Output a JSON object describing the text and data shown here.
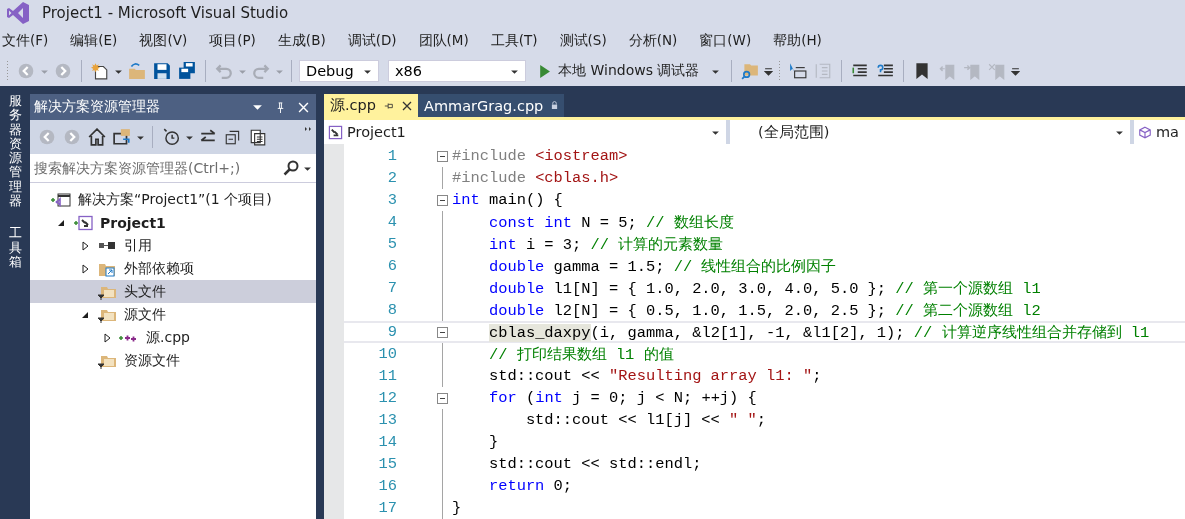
{
  "window": {
    "title": "Project1 - Microsoft Visual Studio"
  },
  "menu": [
    "文件(F)",
    "编辑(E)",
    "视图(V)",
    "项目(P)",
    "生成(B)",
    "调试(D)",
    "团队(M)",
    "工具(T)",
    "测试(S)",
    "分析(N)",
    "窗口(W)",
    "帮助(H)"
  ],
  "toolbar": {
    "configuration": "Debug",
    "platform": "x86",
    "run_label": "本地 Windows 调试器"
  },
  "side_strip": [
    "服务器资源管理器",
    "工具箱"
  ],
  "solution_explorer": {
    "title": "解决方案资源管理器",
    "search": {
      "placeholder": "搜索解决方案资源管理器(Ctrl+;)"
    },
    "tree": [
      {
        "label": "解决方案“Project1”(1 个项目)",
        "kind": "solution",
        "selected": false,
        "children": [
          {
            "label": "Project1",
            "kind": "project",
            "expanded": true,
            "selected": false,
            "children": [
              {
                "label": "引用",
                "kind": "references",
                "expanded": false,
                "selected": false
              },
              {
                "label": "外部依赖项",
                "kind": "external",
                "expanded": false,
                "selected": false
              },
              {
                "label": "头文件",
                "kind": "folder",
                "selected": true
              },
              {
                "label": "源文件",
                "kind": "folder",
                "expanded": true,
                "selected": false,
                "children": [
                  {
                    "label": "源.cpp",
                    "kind": "file",
                    "expanded": false,
                    "selected": false
                  }
                ]
              },
              {
                "label": "资源文件",
                "kind": "folder",
                "selected": false
              }
            ]
          }
        ]
      }
    ]
  },
  "editor": {
    "tabs": [
      {
        "label": "源.cpp",
        "selected": true
      },
      {
        "label": "AmmarGrag.cpp",
        "selected": false
      }
    ],
    "nav": {
      "project": "Project1",
      "scope": "(全局范围)",
      "member": "ma"
    },
    "lines": [
      {
        "number": "1",
        "fold": true,
        "current": false,
        "tokens": [
          {
            "text": "#include",
            "kind": "pp"
          },
          {
            "text": " <iostream>",
            "kind": "str"
          }
        ]
      },
      {
        "number": "2",
        "fold": false,
        "current": false,
        "tokens": [
          {
            "text": "#include",
            "kind": "pp"
          },
          {
            "text": " <cblas.h>",
            "kind": "str"
          }
        ]
      },
      {
        "number": "3",
        "fold": true,
        "current": false,
        "tokens": [
          {
            "text": "int",
            "kind": "kw"
          },
          {
            "text": " main() {",
            "kind": "tx"
          }
        ]
      },
      {
        "number": "4",
        "fold": false,
        "current": false,
        "tokens": [
          {
            "text": "    const int",
            "kind": "kw"
          },
          {
            "text": " N = 5; ",
            "kind": "tx"
          },
          {
            "text": "// 数组长度",
            "kind": "cm"
          }
        ]
      },
      {
        "number": "5",
        "fold": false,
        "current": false,
        "tokens": [
          {
            "text": "    int",
            "kind": "kw"
          },
          {
            "text": " i = 3; ",
            "kind": "tx"
          },
          {
            "text": "// 计算的元素数量",
            "kind": "cm"
          }
        ]
      },
      {
        "number": "6",
        "fold": false,
        "current": false,
        "tokens": [
          {
            "text": "    double",
            "kind": "kw"
          },
          {
            "text": " gamma = 1.5; ",
            "kind": "tx"
          },
          {
            "text": "// 线性组合的比例因子",
            "kind": "cm"
          }
        ]
      },
      {
        "number": "7",
        "fold": false,
        "current": false,
        "tokens": [
          {
            "text": "    double",
            "kind": "kw"
          },
          {
            "text": " l1[N] = { 1.0, 2.0, 3.0, 4.0, 5.0 }; ",
            "kind": "tx"
          },
          {
            "text": "// 第一个源数组 l1",
            "kind": "cm"
          }
        ]
      },
      {
        "number": "8",
        "fold": false,
        "current": false,
        "tokens": [
          {
            "text": "    double",
            "kind": "kw"
          },
          {
            "text": " l2[N] = { 0.5, 1.0, 1.5, 2.0, 2.5 }; ",
            "kind": "tx"
          },
          {
            "text": "// 第二个源数组 l2",
            "kind": "cm"
          }
        ]
      },
      {
        "number": "9",
        "fold": true,
        "current": true,
        "tokens": [
          {
            "text": "    cblas_daxpy",
            "kind": "ref"
          },
          {
            "text": "(i, gamma, &l2[1], -1, &l1[2], 1); ",
            "kind": "tx"
          },
          {
            "text": "// 计算逆序线性组合并存储到 l1",
            "kind": "cm"
          }
        ]
      },
      {
        "number": "10",
        "fold": false,
        "current": false,
        "tokens": [
          {
            "text": "    // 打印结果数组 l1 的值",
            "kind": "cm"
          }
        ]
      },
      {
        "number": "11",
        "fold": false,
        "current": false,
        "tokens": [
          {
            "text": "    std::cout << ",
            "kind": "tx"
          },
          {
            "text": "\"Resulting array l1: \"",
            "kind": "str"
          },
          {
            "text": ";",
            "kind": "tx"
          }
        ]
      },
      {
        "number": "12",
        "fold": true,
        "current": false,
        "tokens": [
          {
            "text": "    for",
            "kind": "kw"
          },
          {
            "text": " (",
            "kind": "tx"
          },
          {
            "text": "int",
            "kind": "kw"
          },
          {
            "text": " j = 0; j < N; ++j) {",
            "kind": "tx"
          }
        ]
      },
      {
        "number": "13",
        "fold": false,
        "current": false,
        "tokens": [
          {
            "text": "        std::cout << l1[j] << ",
            "kind": "tx"
          },
          {
            "text": "\" \"",
            "kind": "str"
          },
          {
            "text": ";",
            "kind": "tx"
          }
        ]
      },
      {
        "number": "14",
        "fold": false,
        "current": false,
        "tokens": [
          {
            "text": "    }",
            "kind": "tx"
          }
        ]
      },
      {
        "number": "15",
        "fold": false,
        "current": false,
        "tokens": [
          {
            "text": "    std::cout << std::endl;",
            "kind": "tx"
          }
        ]
      },
      {
        "number": "16",
        "fold": false,
        "current": false,
        "tokens": [
          {
            "text": "    return",
            "kind": "kw"
          },
          {
            "text": " 0;",
            "kind": "tx"
          }
        ]
      },
      {
        "number": "17",
        "fold": false,
        "current": false,
        "tokens": [
          {
            "text": "}",
            "kind": "tx"
          }
        ]
      }
    ]
  }
}
